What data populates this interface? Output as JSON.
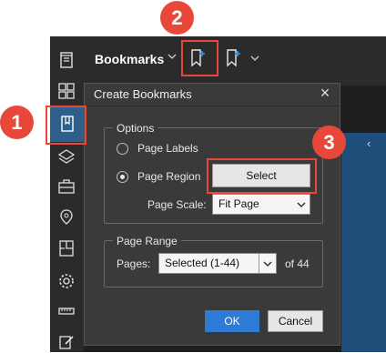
{
  "header": {
    "title": "Bookmarks",
    "title_chevron": "chevron-down-icon",
    "add_bookmark_icon": "bookmark-add-icon",
    "add_child_bookmark_icon": "bookmark-add-child-icon"
  },
  "sidebar": {
    "items": [
      {
        "icon": "document-properties-icon"
      },
      {
        "icon": "thumbnails-icon"
      },
      {
        "icon": "bookmarks-icon",
        "active": true
      },
      {
        "icon": "layers-icon"
      },
      {
        "icon": "briefcase-icon"
      },
      {
        "icon": "location-icon"
      },
      {
        "icon": "page-split-icon"
      },
      {
        "icon": "gear-icon"
      },
      {
        "icon": "ruler-icon"
      },
      {
        "icon": "edit-icon"
      }
    ]
  },
  "dialog": {
    "title": "Create Bookmarks",
    "options": {
      "legend": "Options",
      "page_labels": "Page Labels",
      "page_region": "Page Region",
      "selected": "Page Region",
      "select_button": "Select",
      "page_scale_label": "Page Scale:",
      "page_scale_value": "Fit Page"
    },
    "page_range": {
      "legend": "Page Range",
      "pages_label": "Pages:",
      "pages_value": "Selected (1-44)",
      "of_text": "of 44"
    },
    "ok_button": "OK",
    "cancel_button": "Cancel"
  },
  "callouts": {
    "one": "1",
    "two": "2",
    "three": "3"
  },
  "colors": {
    "accent": "#2e7bd6",
    "callout": "#e8483a",
    "toolbar_bg": "#2b2b2b",
    "dialog_bg": "#3a3a3a"
  }
}
